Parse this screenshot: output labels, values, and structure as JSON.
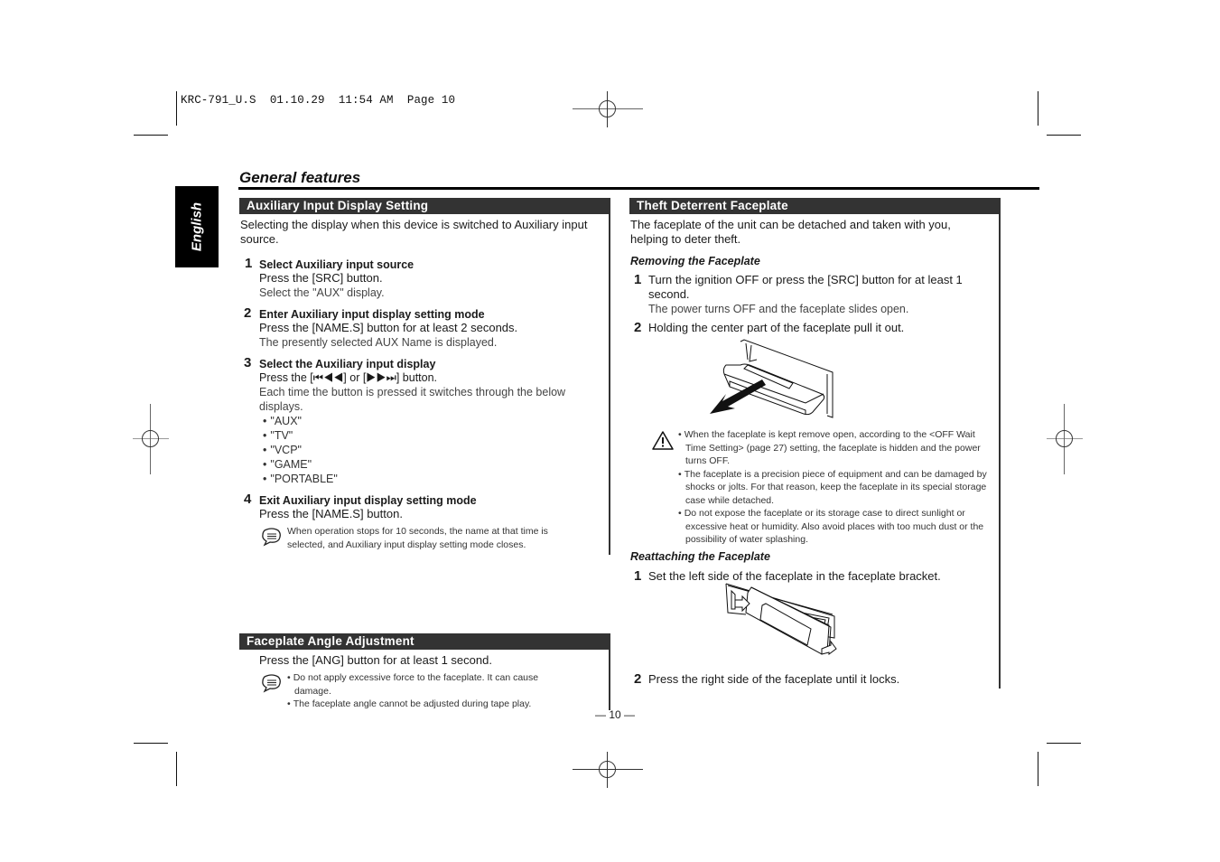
{
  "slug": "KRC-791_U.S  01.10.29  11:54 AM  Page 10",
  "language_tab": "English",
  "page_title": "General features",
  "left": {
    "aux": {
      "heading": "Auxiliary Input Display Setting",
      "intro": "Selecting the display when this device is switched to Auxiliary input source.",
      "steps": [
        {
          "num": "1",
          "title": "Select Auxiliary input source",
          "action": "Press the [SRC] button.",
          "detail": "Select the \"AUX\" display."
        },
        {
          "num": "2",
          "title": "Enter Auxiliary input display setting mode",
          "action": "Press the [NAME.S] button for at least 2 seconds.",
          "detail": "The presently selected AUX Name is displayed."
        },
        {
          "num": "3",
          "title": "Select the Auxiliary input display",
          "action": "Press the [⏮◀◀] or [▶▶⏭] button.",
          "detail": "Each time the button is pressed it switches through the below displays."
        },
        {
          "num": "4",
          "title": "Exit Auxiliary input display setting mode",
          "action": "Press the [NAME.S] button."
        }
      ],
      "displays": [
        "\"AUX\"",
        "\"TV\"",
        "\"VCP\"",
        "\"GAME\"",
        "\"PORTABLE\""
      ],
      "note": "When operation stops for 10 seconds, the name at that time is selected, and Auxiliary input display setting mode closes."
    },
    "angle": {
      "heading": "Faceplate Angle Adjustment",
      "action": "Press the [ANG] button for at least 1 second.",
      "notes": [
        "Do not apply excessive force to the faceplate. It can cause damage.",
        "The faceplate angle cannot be adjusted during tape play."
      ]
    }
  },
  "right": {
    "heading": "Theft Deterrent Faceplate",
    "intro": "The faceplate of the unit can be detached and taken with you, helping to deter theft.",
    "removing": {
      "subhead": "Removing the Faceplate",
      "steps": [
        {
          "num": "1",
          "text": "Turn the ignition OFF or press the [SRC] button for at least 1 second.",
          "detail": "The power turns OFF and the faceplate slides open."
        },
        {
          "num": "2",
          "text": "Holding the center part of the faceplate pull it out."
        }
      ]
    },
    "cautions": [
      "When the faceplate is kept remove open, according to the <OFF Wait Time Setting> (page 27) setting, the faceplate is hidden and the power turns OFF.",
      "The faceplate is a precision piece of equipment and can be damaged by shocks or jolts. For that reason, keep the faceplate in its special storage case while detached.",
      "Do not expose the faceplate or its storage case to direct sunlight or excessive heat or humidity. Also avoid places with too much dust or the possibility of water splashing."
    ],
    "reattaching": {
      "subhead": "Reattaching the Faceplate",
      "steps": [
        {
          "num": "1",
          "text": "Set the left side of the faceplate in the faceplate bracket."
        },
        {
          "num": "2",
          "text": "Press the right side of the faceplate until it locks."
        }
      ]
    }
  },
  "page_number": "— 10 —"
}
